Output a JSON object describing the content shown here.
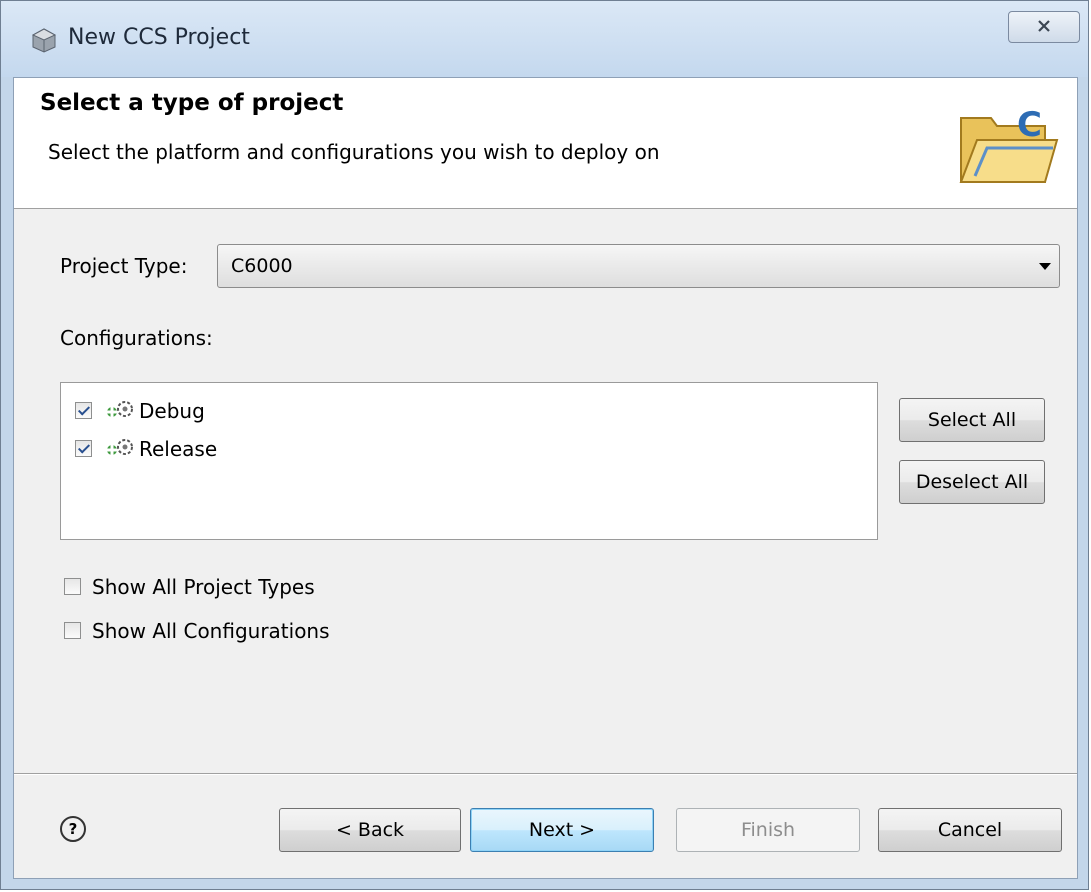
{
  "window": {
    "title": "New CCS Project",
    "title_icon": "app-cube-icon",
    "close_icon": "close-icon"
  },
  "banner": {
    "title": "Select a type of project",
    "subtitle": "Select the platform and configurations you wish to deploy on",
    "icon": "ccs-project-folder-icon"
  },
  "project_type": {
    "label": "Project Type:",
    "value": "C6000"
  },
  "configurations": {
    "label": "Configurations:",
    "items": [
      {
        "label": "Debug",
        "checked": true,
        "icon": "build-config-icon"
      },
      {
        "label": "Release",
        "checked": true,
        "icon": "build-config-icon"
      }
    ],
    "select_all": "Select All",
    "deselect_all": "Deselect All"
  },
  "options": [
    {
      "label": "Show All Project Types",
      "checked": false
    },
    {
      "label": "Show All Configurations",
      "checked": false
    }
  ],
  "footer": {
    "help": "?",
    "back": "< Back",
    "next": "Next >",
    "finish": "Finish",
    "cancel": "Cancel"
  }
}
